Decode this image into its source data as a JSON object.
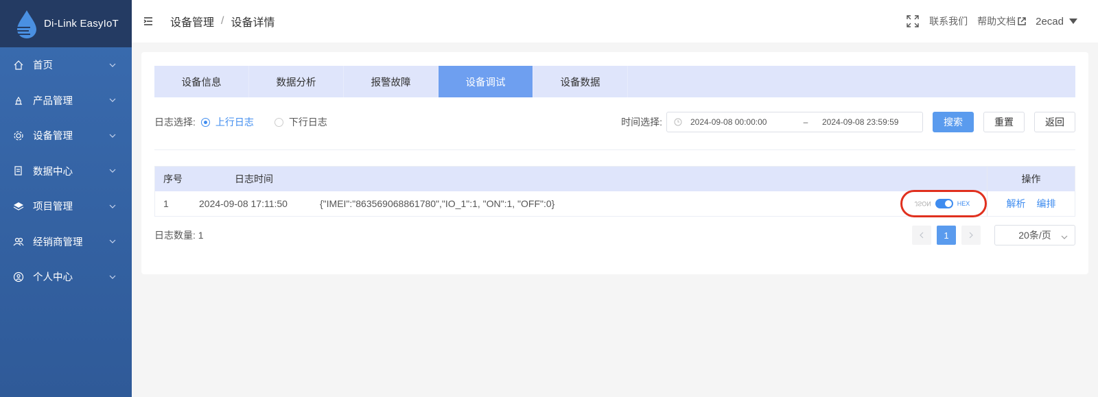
{
  "app": {
    "name": "Di-Link EasyIoT"
  },
  "sidebar": {
    "items": [
      {
        "label": "首页",
        "icon": "home-icon"
      },
      {
        "label": "产品管理",
        "icon": "product-icon"
      },
      {
        "label": "设备管理",
        "icon": "device-gear-icon"
      },
      {
        "label": "数据中心",
        "icon": "data-icon"
      },
      {
        "label": "项目管理",
        "icon": "layers-icon"
      },
      {
        "label": "经销商管理",
        "icon": "dealer-icon"
      },
      {
        "label": "个人中心",
        "icon": "user-circle-icon"
      }
    ]
  },
  "header": {
    "breadcrumb": [
      "设备管理",
      "设备详情"
    ],
    "separator": "/",
    "contact": "联系我们",
    "help": "帮助文档",
    "user": "2ecad"
  },
  "tabs": [
    {
      "label": "设备信息",
      "active": false
    },
    {
      "label": "数据分析",
      "active": false
    },
    {
      "label": "报警故障",
      "active": false
    },
    {
      "label": "设备调试",
      "active": true
    },
    {
      "label": "设备数据",
      "active": false
    }
  ],
  "filters": {
    "log_label": "日志选择:",
    "uplink": "上行日志",
    "downlink": "下行日志",
    "selected": "上行日志",
    "time_label": "时间选择:",
    "start": "2024-09-08 00:00:00",
    "dash": "–",
    "end": "2024-09-08 23:59:59",
    "search": "搜索",
    "reset": "重置",
    "back": "返回"
  },
  "table": {
    "headers": {
      "index": "序号",
      "time": "日志时间",
      "ops": "操作"
    },
    "rows": [
      {
        "index": "1",
        "time": "2024-09-08 17:11:50",
        "content": "{\"IMEI\":\"863569068861780\",\"IO_1\":1, \"ON\":1, \"OFF\":0}",
        "switch_left": "JSON",
        "switch_right": "HEX",
        "parse": "解析",
        "format": "编排"
      }
    ]
  },
  "footer": {
    "count": "日志数量: 1",
    "current_page": "1",
    "page_size": "20条/页"
  },
  "colors": {
    "primary": "#5a9bee",
    "sidebar": "#3a6cb0",
    "tab_active": "#6e9ff0",
    "highlight": "#e0301e"
  }
}
